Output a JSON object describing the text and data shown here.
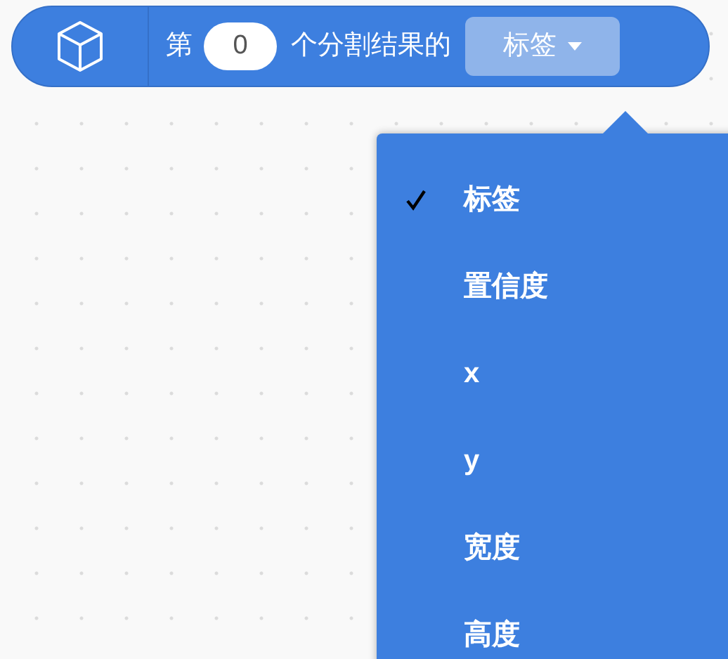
{
  "block": {
    "prefix": "第",
    "index_value": "0",
    "suffix": "个分割结果的",
    "dropdown_value": "标签"
  },
  "menu": {
    "items": [
      {
        "label": "标签",
        "selected": true
      },
      {
        "label": "置信度",
        "selected": false
      },
      {
        "label": "x",
        "selected": false
      },
      {
        "label": "y",
        "selected": false
      },
      {
        "label": "宽度",
        "selected": false
      },
      {
        "label": "高度",
        "selected": false
      }
    ]
  }
}
